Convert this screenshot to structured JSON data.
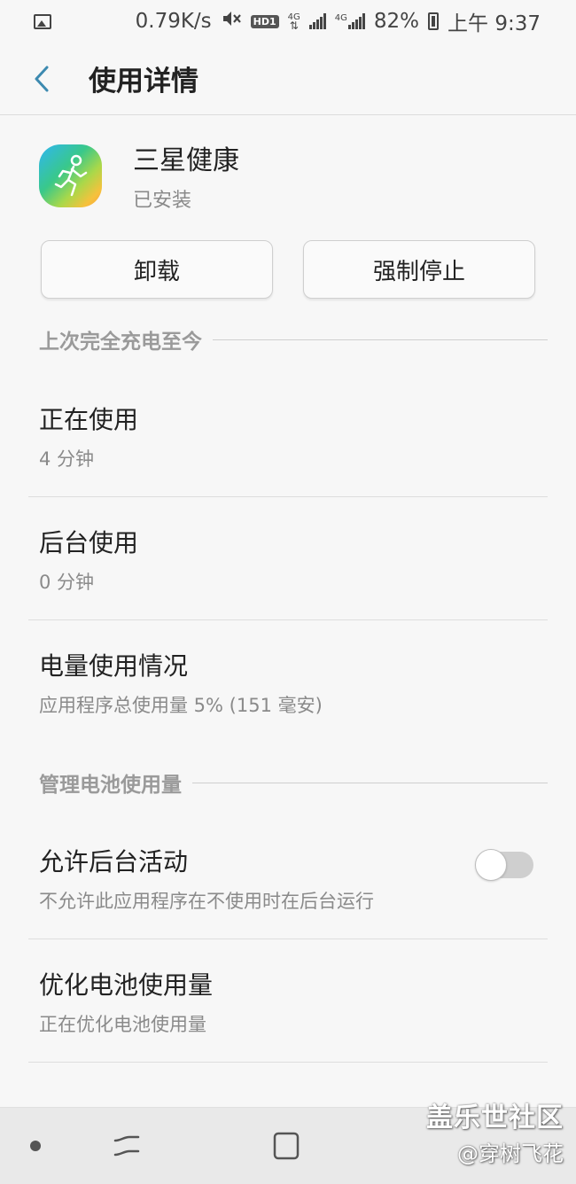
{
  "status_bar": {
    "network_speed": "0.79K/s",
    "hd_label": "HD1",
    "sim1_label": "4G",
    "sim2_label": "4G",
    "battery_percent": "82%",
    "time": "上午 9:37",
    "icons": [
      "image-icon",
      "mute-icon",
      "hd-voice-icon",
      "data-arrows-icon",
      "signal-icon",
      "signal-icon",
      "battery-icon"
    ]
  },
  "header": {
    "title": "使用详情",
    "back_icon": "back-arrow-icon"
  },
  "app": {
    "name": "三星健康",
    "status": "已安装",
    "icon": "samsung-health-icon"
  },
  "actions": {
    "uninstall_label": "卸载",
    "force_stop_label": "强制停止"
  },
  "section_since_charge": {
    "title": "上次完全充电至今",
    "items": [
      {
        "title": "正在使用",
        "value": "4 分钟"
      },
      {
        "title": "后台使用",
        "value": "0 分钟"
      },
      {
        "title": "电量使用情况",
        "value": "应用程序总使用量 5% (151 毫安)"
      }
    ]
  },
  "section_manage_battery": {
    "title": "管理电池使用量",
    "allow_background": {
      "title": "允许后台活动",
      "description": "不允许此应用程序在不使用时在后台运行",
      "enabled": false
    },
    "optimize": {
      "title": "优化电池使用量",
      "description": "正在优化电池使用量"
    }
  },
  "nav_bar": {
    "icons": [
      "dot-icon",
      "recent-apps-icon",
      "home-icon"
    ]
  },
  "watermark": {
    "main": "盖乐世社区",
    "sub": "@穿树飞花"
  }
}
